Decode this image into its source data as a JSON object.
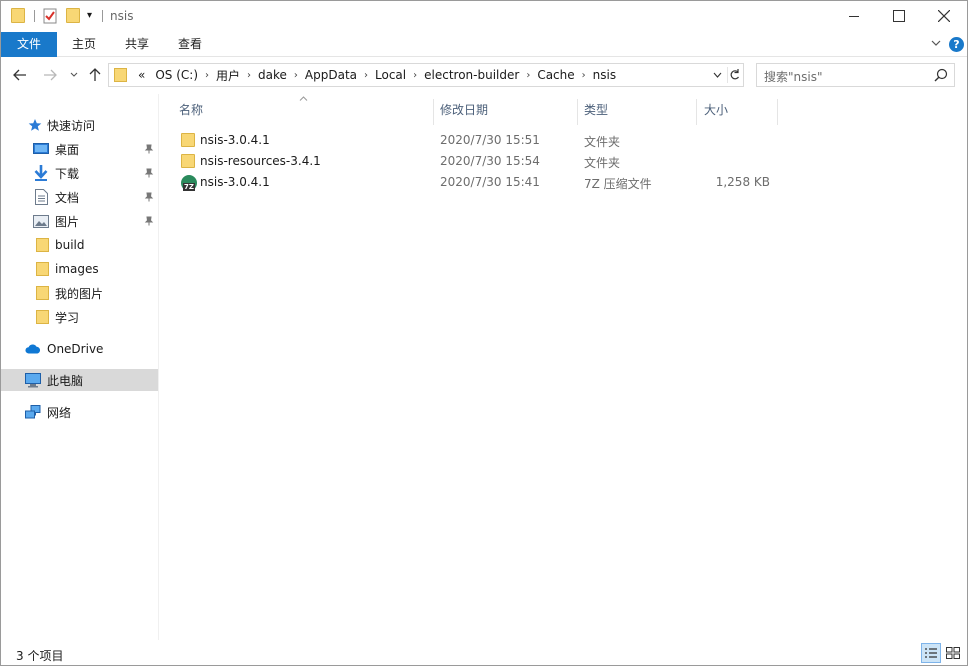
{
  "window": {
    "title": "nsis"
  },
  "ribbon": {
    "tabs": [
      {
        "label": "文件",
        "active": true
      },
      {
        "label": "主页"
      },
      {
        "label": "共享"
      },
      {
        "label": "查看"
      }
    ],
    "help_label": "?"
  },
  "address": {
    "overflow": "«",
    "crumbs": [
      "OS (C:)",
      "用户",
      "dake",
      "AppData",
      "Local",
      "electron-builder",
      "Cache",
      "nsis"
    ],
    "crumb_separator": "›"
  },
  "search": {
    "placeholder": "搜索\"nsis\""
  },
  "nav_pane": {
    "items": [
      {
        "label": "快速访问",
        "icon": "star-icon"
      },
      {
        "label": "桌面",
        "icon": "desktop-icon",
        "pinned": true
      },
      {
        "label": "下载",
        "icon": "download-icon",
        "pinned": true
      },
      {
        "label": "文档",
        "icon": "document-icon",
        "pinned": true
      },
      {
        "label": "图片",
        "icon": "picture-icon",
        "pinned": true
      },
      {
        "label": "build",
        "icon": "folder-icon"
      },
      {
        "label": "images",
        "icon": "folder-icon"
      },
      {
        "label": "我的图片",
        "icon": "folder-icon"
      },
      {
        "label": "学习",
        "icon": "folder-icon"
      },
      {
        "label": "OneDrive",
        "icon": "cloud-icon"
      },
      {
        "label": "此电脑",
        "icon": "computer-icon",
        "selected": true
      },
      {
        "label": "网络",
        "icon": "network-icon"
      }
    ]
  },
  "file_list": {
    "columns": [
      "名称",
      "修改日期",
      "类型",
      "大小"
    ],
    "rows": [
      {
        "name": "nsis-3.0.4.1",
        "modified": "2020/7/30 15:51",
        "type": "文件夹",
        "size": "",
        "icon": "folder-icon"
      },
      {
        "name": "nsis-resources-3.4.1",
        "modified": "2020/7/30 15:54",
        "type": "文件夹",
        "size": "",
        "icon": "folder-icon"
      },
      {
        "name": "nsis-3.0.4.1",
        "modified": "2020/7/30 15:41",
        "type": "7Z 压缩文件",
        "size": "1,258 KB",
        "icon": "7z-archive-icon"
      }
    ]
  },
  "status": {
    "item_count": "3 个项目"
  },
  "colors": {
    "accent": "#1979ca",
    "folder": "#f8d775",
    "selected_nav": "#d9d9d9"
  }
}
